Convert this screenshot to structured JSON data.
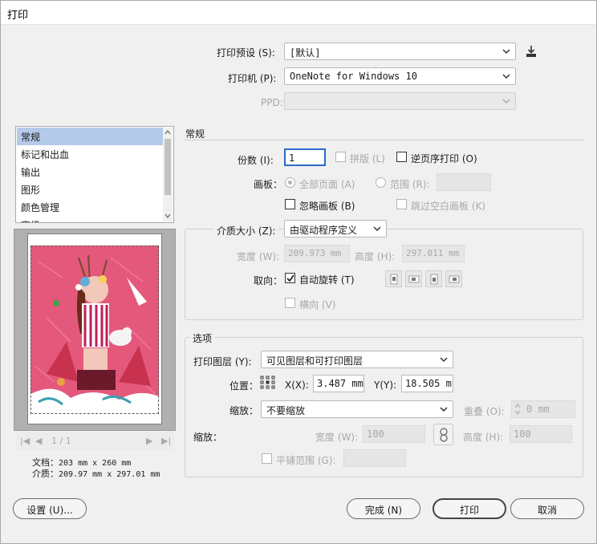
{
  "window": {
    "title": "打印"
  },
  "top": {
    "preset_label": "打印预设 (S):",
    "preset_value": "[默认]",
    "printer_label": "打印机 (P):",
    "printer_value": "OneNote for Windows 10",
    "ppd_label": "PPD:",
    "ppd_value": ""
  },
  "sidebar": {
    "items": [
      {
        "label": "常规",
        "selected": true
      },
      {
        "label": "标记和出血"
      },
      {
        "label": "输出"
      },
      {
        "label": "图形"
      },
      {
        "label": "颜色管理"
      },
      {
        "label": "高级"
      }
    ]
  },
  "preview": {
    "page_indicator": "1 / 1",
    "doc_label": "文档：",
    "doc_size": "203 mm x 260 mm",
    "media_label": "介质：",
    "media_size": "209.97 mm x 297.01 mm"
  },
  "general": {
    "section_title": "常规",
    "copies_label": "份数 (I):",
    "copies_value": "1",
    "collate_label": "拼版 (L)",
    "reverse_label": "逆页序打印 (O)",
    "artboard_label": "画板：",
    "all_pages_label": "全部页面 (A)",
    "range_label": "范围 (R):",
    "range_value": "",
    "ignore_artboard_label": "忽略画板 (B)",
    "skip_blank_label": "跳过空白画板 (K)",
    "media_size_label": "介质大小 (Z):",
    "media_size_value": "由驱动程序定义",
    "width_label": "宽度 (W):",
    "width_value": "209.973 mm",
    "height_label": "高度 (H):",
    "height_value": "297.011 mm",
    "orientation_label": "取向：",
    "auto_rotate_label": "自动旋转 (T)",
    "landscape_label": "横向 (V)"
  },
  "options": {
    "section_title": "选项",
    "layers_label": "打印图层 (Y):",
    "layers_value": "可见图层和可打印图层",
    "position_label": "位置：",
    "x_label": "X(X):",
    "x_value": "3.487 mm",
    "y_label": "Y(Y):",
    "y_value": "18.505 m",
    "scale_label": "缩放：",
    "scale_value": "不要缩放",
    "overlap_label": "重叠 (O):",
    "overlap_value": "0 mm",
    "scale2_label": "缩放：",
    "scale_w_label": "宽度 (W):",
    "scale_w_value": "100",
    "scale_h_label": "高度 (H):",
    "scale_h_value": "100",
    "tile_label": "平铺范围 (G):",
    "tile_value": ""
  },
  "footer": {
    "setup_label": "设置 (U)...",
    "done_label": "完成 (N)",
    "print_label": "打印",
    "cancel_label": "取消"
  },
  "colors": {
    "accent": "#2b6cc7",
    "selected_item_bg": "#b5c9e9",
    "artwork_pink": "#e0567a"
  },
  "icons": {
    "preset_save": "download-icon",
    "dropdown": "chevron-down-icon",
    "checkbox_checked": "check-icon",
    "position_grid": "reference-point-grid-icon",
    "link": "chain-link-icon"
  }
}
